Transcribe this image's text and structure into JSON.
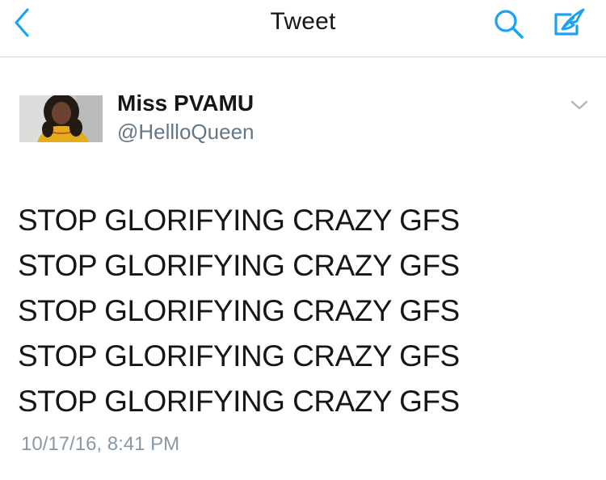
{
  "navbar": {
    "title": "Tweet",
    "icons": {
      "back": "chevron-left-icon",
      "search": "search-icon",
      "compose": "compose-tweet-icon"
    },
    "accent_color": "#1da1f2"
  },
  "tweet": {
    "author": {
      "display_name": "Miss PVAMU",
      "handle": "@HellloQueen"
    },
    "text_lines": [
      "STOP GLORIFYING CRAZY GFS",
      "STOP GLORIFYING CRAZY GFS",
      "STOP GLORIFYING CRAZY GFS",
      "STOP GLORIFYING CRAZY GFS",
      "STOP GLORIFYING CRAZY GFS"
    ],
    "timestamp": "10/17/16, 8:41 PM"
  },
  "colors": {
    "text_primary": "#14171a",
    "text_secondary": "#657786",
    "timestamp": "#8899a6",
    "divider": "#d4d4d8"
  }
}
